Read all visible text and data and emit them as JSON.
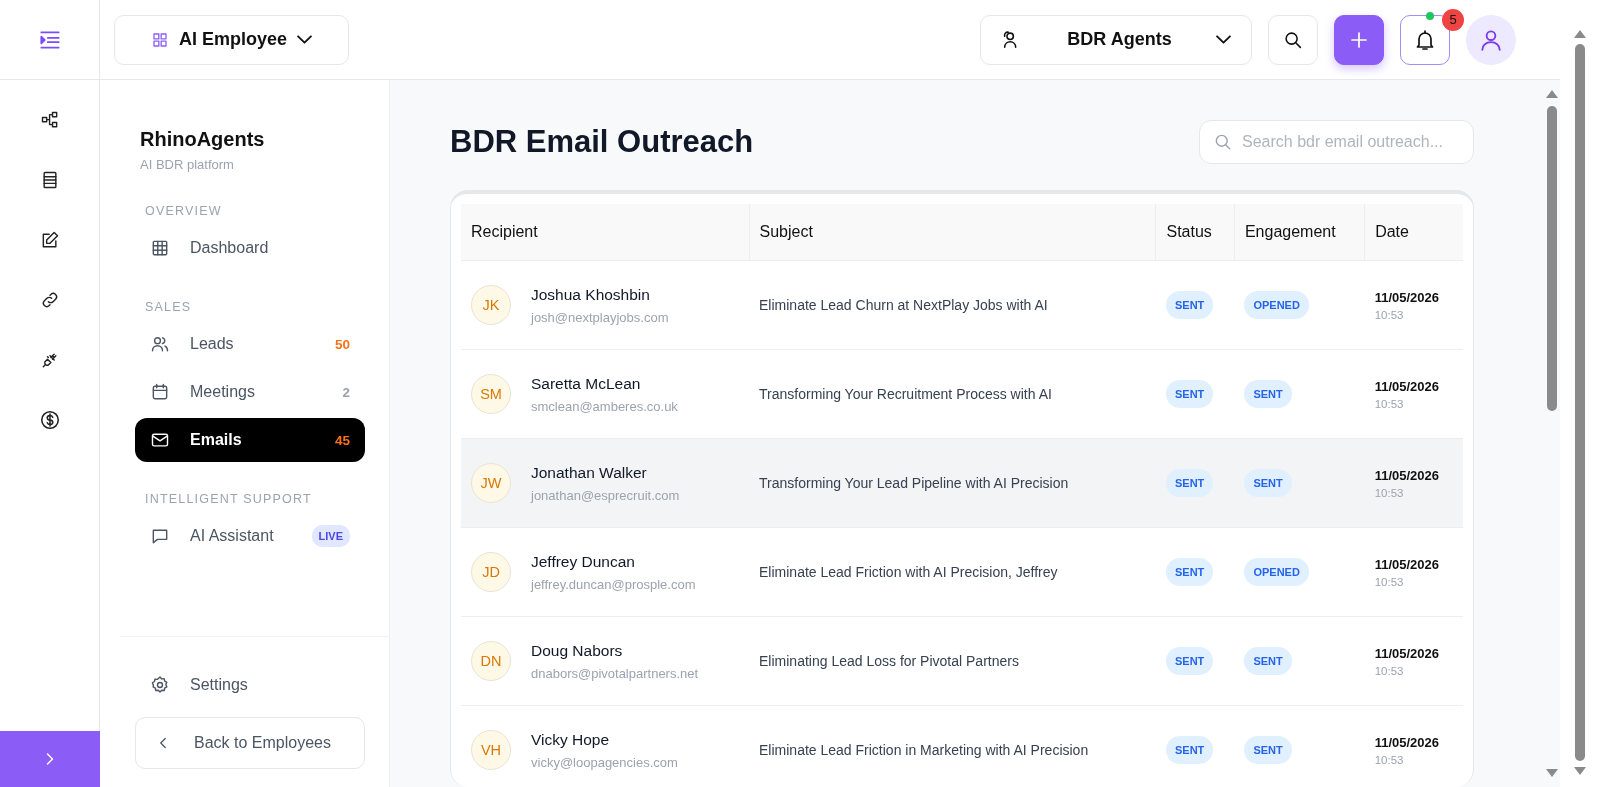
{
  "topbar": {
    "workspace": "AI Employee",
    "agent_select": "BDR Agents",
    "notification_count": "5"
  },
  "sidebar": {
    "brand": "RhinoAgents",
    "tagline": "AI BDR platform",
    "sections": [
      {
        "heading": "OVERVIEW",
        "items": [
          {
            "kind": "grid",
            "label": "Dashboard",
            "selected": false
          }
        ]
      },
      {
        "heading": "SALES",
        "items": [
          {
            "kind": "users",
            "label": "Leads",
            "badge": {
              "text": "50",
              "kind": "count",
              "color": "#f97316"
            },
            "selected": false
          },
          {
            "kind": "calendar",
            "label": "Meetings",
            "badge": {
              "text": "2",
              "kind": "count",
              "color": "#9ca3af"
            },
            "selected": false
          },
          {
            "kind": "mail",
            "label": "Emails",
            "badge": {
              "text": "45",
              "kind": "count",
              "color": "#f97316"
            },
            "selected": true
          }
        ]
      },
      {
        "heading": "INTELLIGENT SUPPORT",
        "items": [
          {
            "kind": "chat",
            "label": "AI Assistant",
            "badge": {
              "text": "LIVE",
              "kind": "pill",
              "color": "#4f46e5"
            },
            "selected": false
          }
        ]
      }
    ],
    "settings": "Settings",
    "back": "Back to Employees"
  },
  "main": {
    "title": "BDR Email Outreach",
    "search": {
      "placeholder": "Search bdr email outreach..."
    },
    "table": {
      "columns": [
        "Recipient",
        "Subject",
        "Status",
        "Engagement",
        "Date"
      ],
      "rows": [
        {
          "initials": "JK",
          "name": "Joshua Khoshbin",
          "email": "josh@nextplayjobs.com",
          "subject": "Eliminate Lead Churn at NextPlay Jobs with AI",
          "status": "SENT",
          "engagement": "OPENED",
          "date": "11/05/2026",
          "time": "10:53",
          "selected": false
        },
        {
          "initials": "SM",
          "name": "Saretta McLean",
          "email": "smclean@amberes.co.uk",
          "subject": "Transforming Your Recruitment Process with AI",
          "status": "SENT",
          "engagement": "SENT",
          "date": "11/05/2026",
          "time": "10:53",
          "selected": false
        },
        {
          "initials": "JW",
          "name": "Jonathan Walker",
          "email": "jonathan@esprecruit.com",
          "subject": "Transforming Your Lead Pipeline with AI Precision",
          "status": "SENT",
          "engagement": "SENT",
          "date": "11/05/2026",
          "time": "10:53",
          "selected": true
        },
        {
          "initials": "JD",
          "name": "Jeffrey Duncan",
          "email": "jeffrey.duncan@prosple.com",
          "subject": "Eliminate Lead Friction with AI Precision, Jeffrey",
          "status": "SENT",
          "engagement": "OPENED",
          "date": "11/05/2026",
          "time": "10:53",
          "selected": false
        },
        {
          "initials": "DN",
          "name": "Doug Nabors",
          "email": "dnabors@pivotalpartners.net",
          "subject": "Eliminating Lead Loss for Pivotal Partners",
          "status": "SENT",
          "engagement": "SENT",
          "date": "11/05/2026",
          "time": "10:53",
          "selected": false
        },
        {
          "initials": "VH",
          "name": "Vicky Hope",
          "email": "vicky@loopagencies.com",
          "subject": "Eliminate Lead Friction in Marketing with AI Precision",
          "status": "SENT",
          "engagement": "SENT",
          "date": "11/05/2026",
          "time": "10:53",
          "selected": false
        }
      ]
    }
  }
}
